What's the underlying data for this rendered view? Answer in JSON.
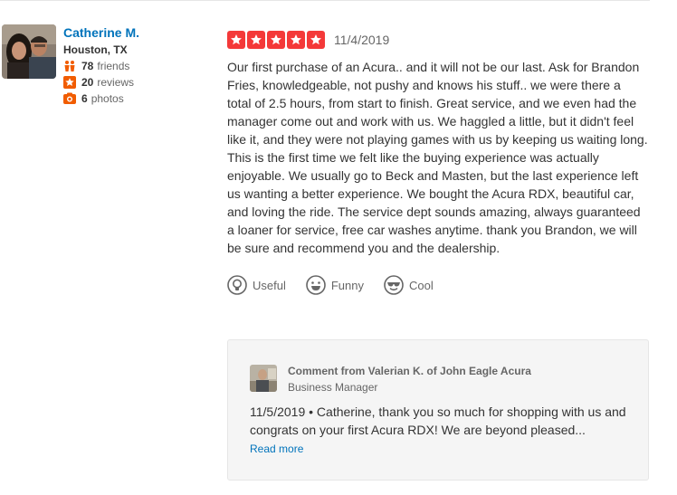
{
  "user": {
    "name": "Catherine M.",
    "location": "Houston, TX",
    "friends_count": "78",
    "friends_label": "friends",
    "reviews_count": "20",
    "reviews_label": "reviews",
    "photos_count": "6",
    "photos_label": "photos"
  },
  "review": {
    "rating": 5,
    "date": "11/4/2019",
    "text": "Our first purchase of an Acura.. and it will not be our last. Ask for Brandon Fries, knowledgeable, not pushy and knows his stuff.. we were there a total of 2.5 hours, from start to finish. Great service, and we even had the manager come out and work with us. We haggled a little, but it didn't feel like it, and they were not playing games with us by keeping us waiting long. This is the first time we felt like the buying experience was actually enjoyable. We usually go to Beck and Masten, but the last experience left us wanting a better experience. We bought the Acura RDX, beautiful car, and loving the ride. The service dept sounds amazing, always guaranteed a loaner for service, free car washes anytime. thank you Brandon, we will be sure and recommend you and the dealership.",
    "votes": {
      "useful": "Useful",
      "funny": "Funny",
      "cool": "Cool"
    }
  },
  "business_comment": {
    "title": "Comment from Valerian K. of John Eagle Acura",
    "role": "Business Manager",
    "text": "11/5/2019 • Catherine, thank you so much for shopping with us and congrats on your first Acura RDX! We are beyond pleased...",
    "read_more": "Read more"
  },
  "colors": {
    "star": "#f43939",
    "link": "#0073bb",
    "accent_orange": "#f15c00",
    "comment_bg": "#f5f5f5"
  },
  "icons": {
    "friends": "friends-icon",
    "reviews": "star-badge-icon",
    "photos": "camera-icon",
    "useful": "lightbulb-icon",
    "funny": "smile-icon",
    "cool": "sunglasses-icon"
  }
}
